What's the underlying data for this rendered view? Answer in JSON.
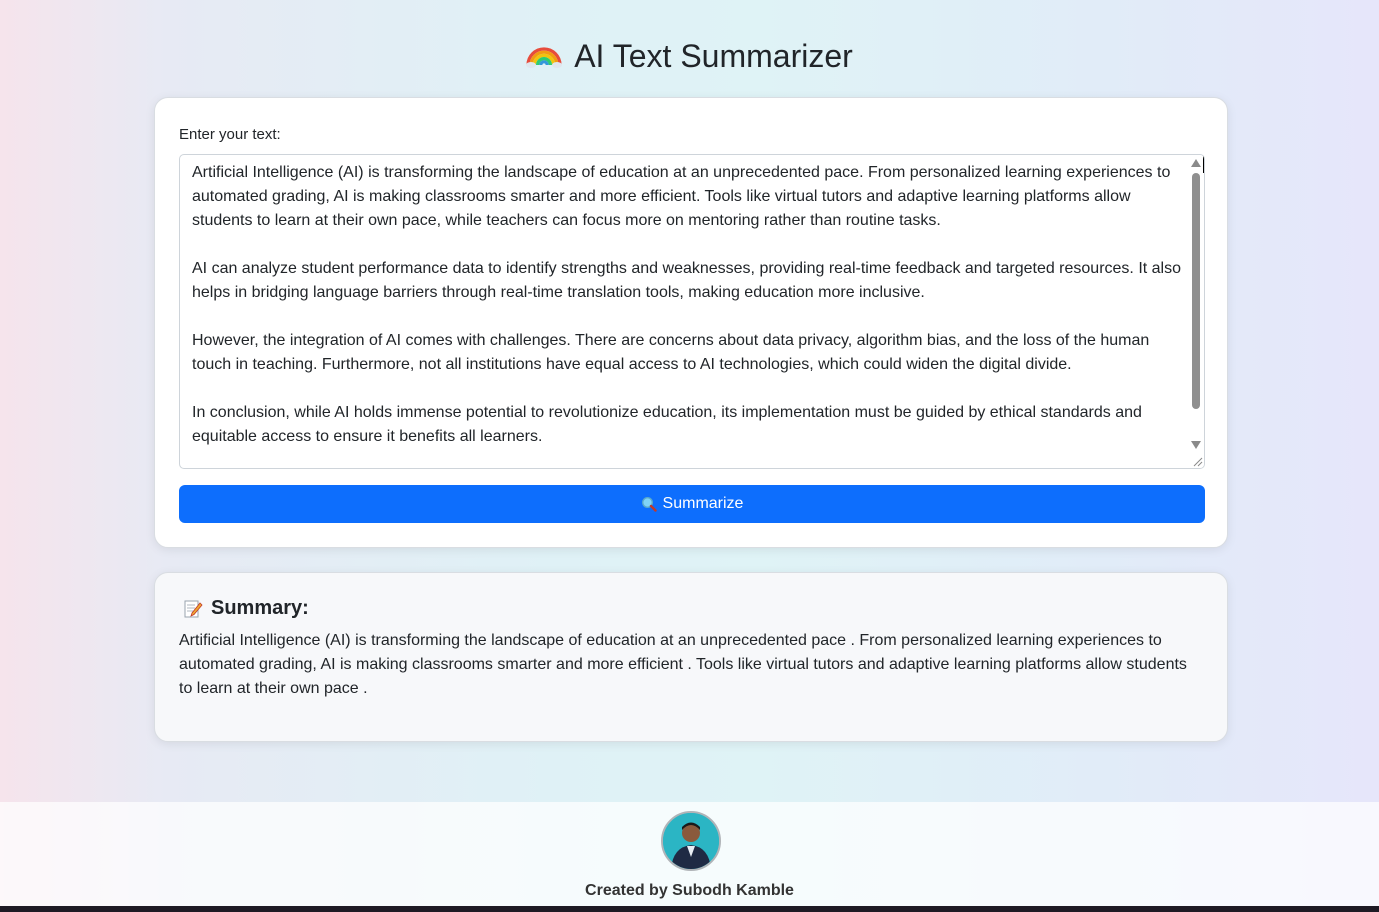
{
  "app": {
    "title": "AI Text Summarizer",
    "title_icon": "rainbow-icon"
  },
  "input": {
    "label": "Enter your text:",
    "paragraphs": [
      "Artificial Intelligence (AI) is transforming the landscape of education at an unprecedented pace. From personalized learning experiences to automated grading, AI is making classrooms smarter and more efficient. Tools like virtual tutors and adaptive learning platforms allow students to learn at their own pace, while teachers can focus more on mentoring rather than routine tasks.",
      "AI can analyze student performance data to identify strengths and weaknesses, providing real-time feedback and targeted resources. It also helps in bridging language barriers through real-time translation tools, making education more inclusive.",
      "However, the integration of AI comes with challenges. There are concerns about data privacy, algorithm bias, and the loss of the human touch in teaching. Furthermore, not all institutions have equal access to AI technologies, which could widen the digital divide.",
      "In conclusion, while AI holds immense potential to revolutionize education, its implementation must be guided by ethical standards and equitable access to ensure it benefits all learners."
    ]
  },
  "button": {
    "label": "Summarize",
    "icon": "magnifier-icon",
    "color": "#0d6efd"
  },
  "summary": {
    "heading": "Summary:",
    "icon": "memo-icon",
    "text": "Artificial Intelligence (AI) is transforming the landscape of education at an unprecedented pace . From personalized learning experiences to automated grading, AI is making classrooms smarter and more efficient . Tools like virtual tutors and adaptive learning platforms allow students to learn at their own pace ."
  },
  "footer": {
    "credit": "Created by Subodh Kamble"
  }
}
